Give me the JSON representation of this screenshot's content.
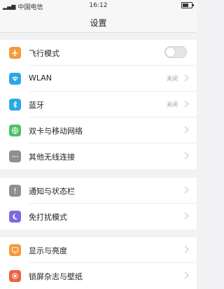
{
  "statusbar": {
    "carrier": "中国电信",
    "time": "16:12"
  },
  "header": {
    "title": "设置"
  },
  "groups": [
    {
      "items": [
        {
          "label": "飞行模式",
          "icon": "airplane-icon",
          "color": "#f39a3b",
          "control": "toggle",
          "on": false
        },
        {
          "label": "WLAN",
          "icon": "wifi-icon",
          "color": "#2aa7e8",
          "value": "关闭"
        },
        {
          "label": "蓝牙",
          "icon": "bluetooth-icon",
          "color": "#2aa7e8",
          "value": "关闭"
        },
        {
          "label": "双卡与移动网络",
          "icon": "globe-icon",
          "color": "#4cc266"
        },
        {
          "label": "其他无线连接",
          "icon": "more-icon",
          "color": "#8e8e93"
        }
      ]
    },
    {
      "items": [
        {
          "label": "通知与状态栏",
          "icon": "notification-icon",
          "color": "#8e8e93"
        },
        {
          "label": "免打扰模式",
          "icon": "moon-icon",
          "color": "#7b6be0"
        }
      ]
    },
    {
      "items": [
        {
          "label": "显示与亮度",
          "icon": "display-icon",
          "color": "#f39a3b"
        },
        {
          "label": "锁屏杂志与壁纸",
          "icon": "wallpaper-icon",
          "color": "#f0613f"
        }
      ]
    }
  ]
}
